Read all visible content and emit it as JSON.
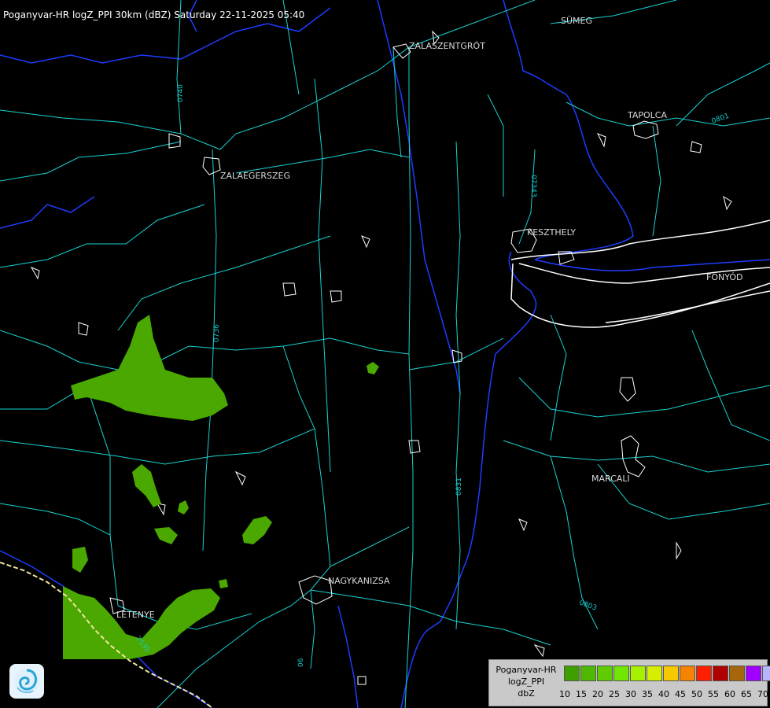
{
  "header": {
    "title": "Poganyvar-HR logZ_PPI 30km (dBZ) Saturday 22-11-2025 05:40"
  },
  "cities": [
    {
      "name": "SÜMEG"
    },
    {
      "name": "ZALASZENTGRÓT"
    },
    {
      "name": "TAPOLCA"
    },
    {
      "name": "ZALAEGERSZEG"
    },
    {
      "name": "KESZTHELY"
    },
    {
      "name": "FONYÓD"
    },
    {
      "name": "MARCALI"
    },
    {
      "name": "NAGYKANIZSA"
    },
    {
      "name": "LETENYE"
    }
  ],
  "road_labels": [
    "0740",
    "0736",
    "07343",
    "0831",
    "0803",
    "06",
    "0801",
    "7535"
  ],
  "legend": {
    "line1": "Poganyvar-HR",
    "line2": "logZ_PPI",
    "line3": "dbZ",
    "levels": [
      {
        "value": "10",
        "color": "#3f9e00"
      },
      {
        "value": "15",
        "color": "#4fb800"
      },
      {
        "value": "20",
        "color": "#5ecc00"
      },
      {
        "value": "25",
        "color": "#71e600"
      },
      {
        "value": "30",
        "color": "#a6f000"
      },
      {
        "value": "35",
        "color": "#d6ee00"
      },
      {
        "value": "40",
        "color": "#f5c800"
      },
      {
        "value": "45",
        "color": "#f58200"
      },
      {
        "value": "50",
        "color": "#ff1e00"
      },
      {
        "value": "55",
        "color": "#b00000"
      },
      {
        "value": "60",
        "color": "#a8660c"
      },
      {
        "value": "65",
        "color": "#a000ff"
      },
      {
        "value": "70",
        "color": "#b4b4ff"
      }
    ],
    "last_label": "70"
  },
  "colors": {
    "background": "#000000",
    "roads": "#19d2d2",
    "rivers": "#1e3cff",
    "settlements": "#ffffff",
    "echo": "#4aa800"
  }
}
